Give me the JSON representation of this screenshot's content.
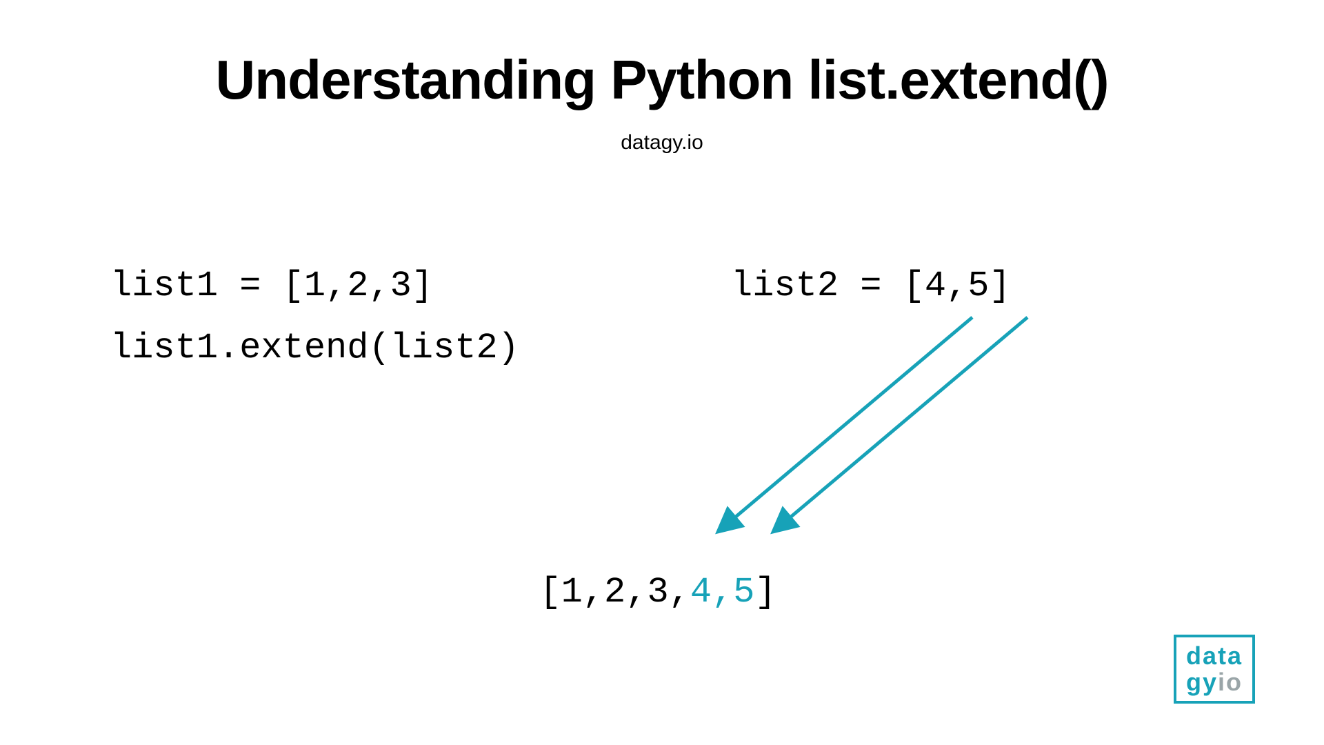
{
  "title": "Understanding Python list.extend()",
  "subtitle": "datagy.io",
  "code": {
    "line1": "list1 = [1,2,3]",
    "line2": "list2 = [4,5]",
    "line3": "list1.extend(list2)"
  },
  "result": {
    "prefix": "[1,2,3,",
    "highlight": "4,5",
    "suffix": "]"
  },
  "logo": {
    "row1": "data",
    "row2a": "gy",
    "row2b": "io"
  },
  "colors": {
    "accent": "#17a2b8"
  }
}
